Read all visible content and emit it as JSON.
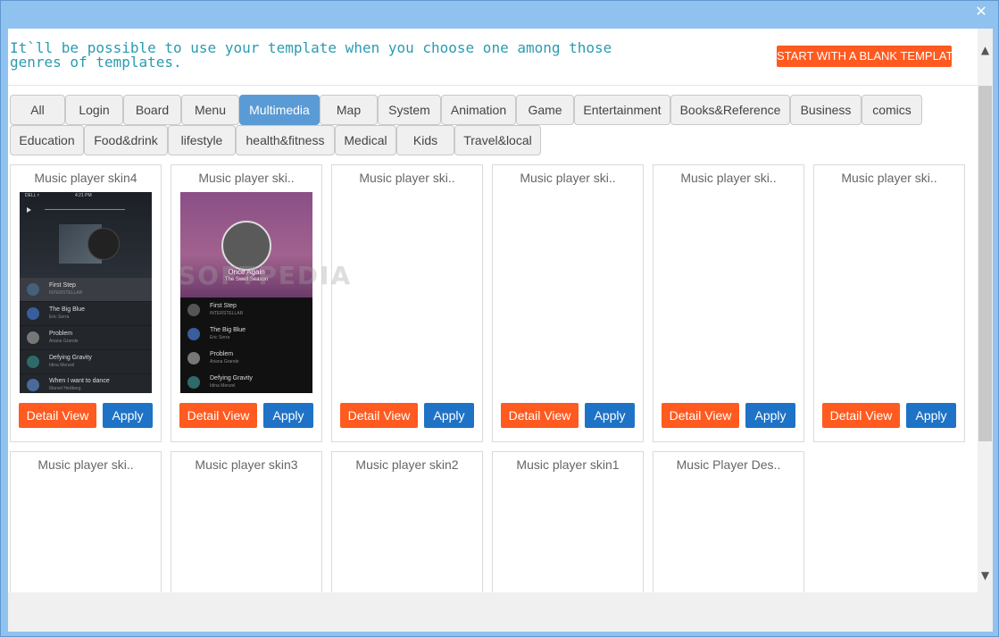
{
  "window": {
    "close_glyph": "✕"
  },
  "header": {
    "message": "It`ll be possible to use your template when you choose one among those genres of templates.",
    "blank_template_label": "START WITH A BLANK TEMPLATE"
  },
  "tabs": {
    "row1": [
      "All",
      "Login",
      "Board",
      "Menu",
      "Multimedia",
      "Map",
      "System",
      "Animation",
      "Game",
      "Entertainment",
      "Books&Reference",
      "Business",
      "comics"
    ],
    "row2": [
      "Education",
      "Food&drink",
      "lifestyle",
      "health&fitness",
      "Medical",
      "Kids",
      "Travel&local"
    ],
    "active": "Multimedia"
  },
  "cards": [
    {
      "title": "Music player skin4",
      "detail": "Detail View",
      "apply": "Apply"
    },
    {
      "title": "Music player ski..",
      "detail": "Detail View",
      "apply": "Apply"
    },
    {
      "title": "Music player ski..",
      "detail": "Detail View",
      "apply": "Apply"
    },
    {
      "title": "Music player ski..",
      "detail": "Detail View",
      "apply": "Apply"
    },
    {
      "title": "Music player ski..",
      "detail": "Detail View",
      "apply": "Apply"
    },
    {
      "title": "Music player ski..",
      "detail": "Detail View",
      "apply": "Apply"
    },
    {
      "title": "Music player ski.."
    },
    {
      "title": "Music player skin3"
    },
    {
      "title": "Music player skin2"
    },
    {
      "title": "Music player skin1"
    },
    {
      "title": "Music Player Des.."
    }
  ],
  "thumb1": {
    "status": "DELL ᴛ",
    "time": "4:21 PM",
    "tracks": [
      {
        "title": "First Step",
        "artist": "INTERSTELLAR"
      },
      {
        "title": "The Big Blue",
        "artist": "Eric Serra"
      },
      {
        "title": "Problem",
        "artist": "Ariana Grande"
      },
      {
        "title": "Defying Gravity",
        "artist": "Idina Menzel"
      },
      {
        "title": "When I want to dance",
        "artist": "Marvel Hedberg"
      }
    ]
  },
  "thumb2": {
    "now_playing": "Once Again",
    "now_artist": "The Swell Season",
    "tracks": [
      {
        "title": "First Step",
        "artist": "INTERSTELLAR"
      },
      {
        "title": "The Big Blue",
        "artist": "Eric Serra"
      },
      {
        "title": "Problem",
        "artist": "Ariana Grande"
      },
      {
        "title": "Defying Gravity",
        "artist": "Idina Menzel"
      }
    ]
  },
  "watermark": "SOFTPEDIA",
  "colors": {
    "accent_orange": "#ff5a1f",
    "accent_blue": "#1f73c6",
    "tab_active": "#5b9bd5",
    "header_text": "#2a9bb0"
  }
}
